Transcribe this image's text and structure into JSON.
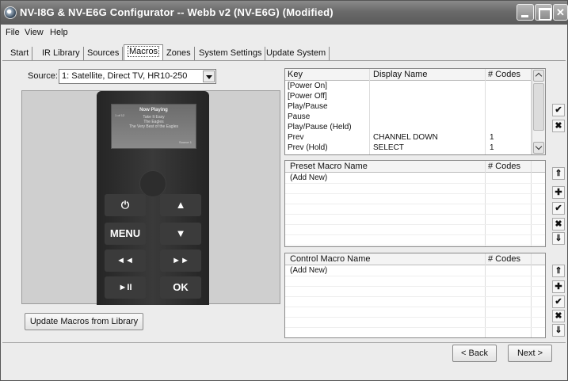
{
  "window": {
    "title": "NV-I8G & NV-E6G Configurator -- Webb v2 (NV-E6G) (Modified)"
  },
  "menu": [
    "File",
    "View",
    "Help"
  ],
  "tabs": [
    "Start",
    "IR Library",
    "Sources",
    "Macros",
    "Zones",
    "System Settings",
    "Update System"
  ],
  "active_tab": "Macros",
  "source": {
    "label": "Source:",
    "value": "1: Satellite, Direct TV, HR10-250"
  },
  "remote": {
    "screen_title": "Now Playing",
    "screen_small": "1 of 12",
    "screen_lines": [
      "Take It Easy",
      "The Eagles",
      "The Very Best of the Eagles"
    ],
    "screen_footer": "Source 1",
    "buttons": {
      "power": "⏻",
      "up": "▲",
      "menu": "MENU",
      "down": "▼",
      "rew": "◄◄",
      "ffwd": "►►",
      "playpause": "►II",
      "ok": "OK"
    }
  },
  "update_button": "Update Macros from Library",
  "keys_table": {
    "headers": [
      "Key",
      "Display Name",
      "# Codes"
    ],
    "rows": [
      {
        "key": "[Power On]",
        "display": "",
        "codes": ""
      },
      {
        "key": "[Power Off]",
        "display": "",
        "codes": ""
      },
      {
        "key": "Play/Pause",
        "display": "",
        "codes": ""
      },
      {
        "key": "Pause",
        "display": "",
        "codes": ""
      },
      {
        "key": "Play/Pause (Held)",
        "display": "",
        "codes": ""
      },
      {
        "key": "Prev",
        "display": "CHANNEL DOWN",
        "codes": "1"
      },
      {
        "key": "Prev (Hold)",
        "display": "SELECT",
        "codes": "1"
      }
    ]
  },
  "preset_table": {
    "headers": [
      "Preset Macro Name",
      "# Codes"
    ],
    "rows": [
      "(Add New)"
    ]
  },
  "control_table": {
    "headers": [
      "Control Macro Name",
      "# Codes"
    ],
    "rows": [
      "(Add New)"
    ]
  },
  "side_buttons": {
    "accept": "✔",
    "remove": "✖",
    "move_up": "⇑",
    "add": "✚",
    "move_down": "⇓"
  },
  "nav": {
    "back": "< Back",
    "next": "Next >"
  }
}
